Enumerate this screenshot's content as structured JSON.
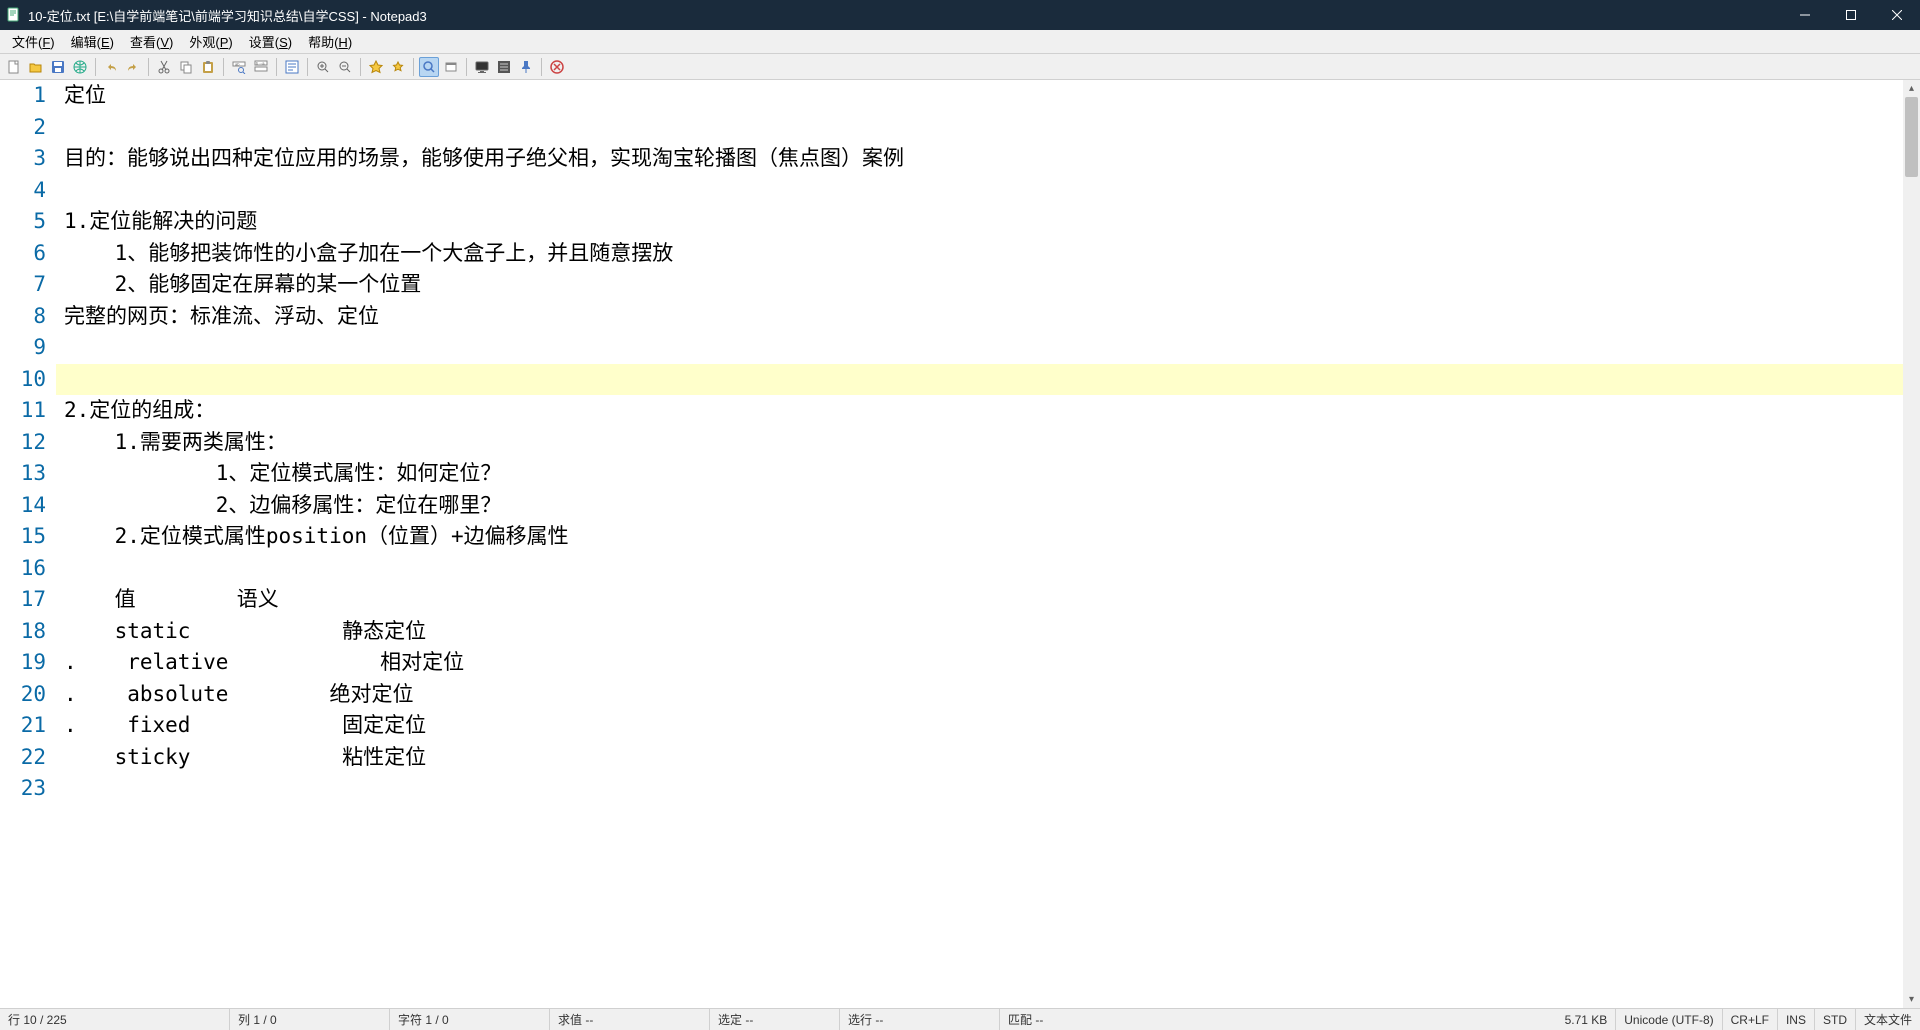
{
  "window": {
    "title": "10-定位.txt [E:\\自学前端笔记\\前端学习知识总结\\自学CSS] - Notepad3"
  },
  "menubar": {
    "items": [
      {
        "label": "文件",
        "accel": "F"
      },
      {
        "label": "编辑",
        "accel": "E"
      },
      {
        "label": "查看",
        "accel": "V"
      },
      {
        "label": "外观",
        "accel": "P"
      },
      {
        "label": "设置",
        "accel": "S"
      },
      {
        "label": "帮助",
        "accel": "H"
      }
    ]
  },
  "toolbar": {
    "buttons": [
      "new-file",
      "open-file",
      "save-file",
      "web",
      "sep",
      "undo",
      "redo",
      "sep",
      "cut",
      "copy",
      "paste",
      "sep",
      "find",
      "replace",
      "sep",
      "word-wrap",
      "sep",
      "zoom-in",
      "zoom-out",
      "sep",
      "bookmark",
      "bookmark-clear",
      "sep",
      "zoom-reset",
      "toggle-toolbar",
      "sep",
      "monitor",
      "line-numbers",
      "pin",
      "sep",
      "cancel"
    ]
  },
  "editor": {
    "currentLine": 10,
    "lines": [
      "定位",
      "",
      "目的：能够说出四种定位应用的场景，能够使用子绝父相，实现淘宝轮播图（焦点图）案例",
      "",
      "1.定位能解决的问题",
      "\t1、能够把装饰性的小盒子加在一个大盒子上，并且随意摆放",
      "\t2、能够固定在屏幕的某一个位置",
      "完整的网页：标准流、浮动、定位",
      "",
      "",
      "2.定位的组成：",
      "\t1.需要两类属性：",
      "\t\t\t1、定位模式属性：如何定位？",
      "\t\t\t2、边偏移属性：定位在哪里？",
      "\t2.定位模式属性position（位置）+边偏移属性",
      "",
      "\t值\t\t语义",
      "\tstatic\t\t\t静态定位",
      ".\trelative\t\t\t相对定位",
      ".\tabsolute\t\t绝对定位",
      ".\tfixed\t\t\t固定定位",
      "\tsticky\t\t\t粘性定位",
      ""
    ]
  },
  "statusbar": {
    "line": "行  10 / 225",
    "col": "列  1 / 0",
    "chars": "字符  1 / 0",
    "eval": "求值  --",
    "sel": "选定  --",
    "sellines": "选行  --",
    "match": "匹配  --",
    "size": "5.71 KB",
    "encoding": "Unicode (UTF-8)",
    "eol": "CR+LF",
    "ins": "INS",
    "std": "STD",
    "filetype": "文本文件"
  }
}
